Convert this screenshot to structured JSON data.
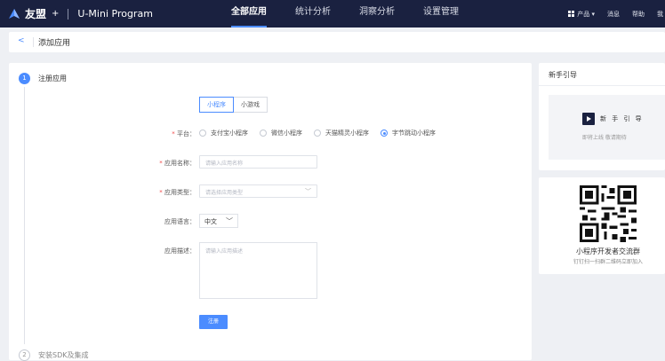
{
  "header": {
    "brand": "友盟",
    "brand_plus": "+",
    "product": "U-Mini Program",
    "nav": [
      "全部应用",
      "统计分析",
      "洞察分析",
      "设置管理"
    ],
    "right_items": [
      "产品 ▾",
      "消息",
      "帮助",
      "我"
    ]
  },
  "subbar": {
    "back": "<",
    "title": "添加应用"
  },
  "steps": {
    "step1_number": "1",
    "step1_label": "注册应用",
    "step2_number": "2",
    "step2_label": "安装SDK及集成"
  },
  "form": {
    "tabs": [
      "小程序",
      "小游戏"
    ],
    "platform_label": "平台：",
    "platforms": [
      "支付宝小程序",
      "微信小程序",
      "天猫精灵小程序",
      "字节跳动小程序"
    ],
    "platform_selected": "字节跳动小程序",
    "name_label": "应用名称：",
    "name_placeholder": "请输入应用名称",
    "type_label": "应用类型：",
    "type_placeholder": "请选择应用类型",
    "lang_label": "应用语言：",
    "lang_value": "中文",
    "desc_label": "应用描述：",
    "desc_placeholder": "请输入应用描述",
    "submit_label": "注册"
  },
  "sidebar": {
    "guide_title": "新手引导",
    "guide_card_title": "新 手 引 导",
    "guide_card_sub": "即将上线  敬请期待",
    "qr_title": "小程序开发者交流群",
    "qr_sub": "钉钉扫一扫群二维码立即加入"
  },
  "colors": {
    "topbar": "#1a2140",
    "accent": "#4b8cff",
    "background": "#eef0f4"
  }
}
